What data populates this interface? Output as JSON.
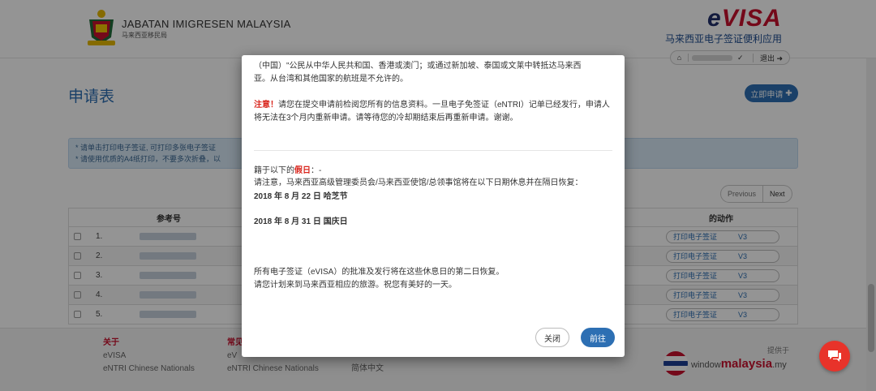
{
  "header": {
    "org_title": "JABATAN IMIGRESEN MALAYSIA",
    "org_subtitle": "马来西亚移民局",
    "logo_text": "eVISA",
    "app_subtitle": "马来西亚电子签证便利应用",
    "nav": {
      "home_icon": "home-icon",
      "user_dropdown_icon": "chevron-down-icon",
      "logout_label": "退出"
    }
  },
  "page": {
    "title": "申请表",
    "apply_button": "立即申请",
    "notice_lines": [
      "* 请单击打印电子签证, 可打印多张电子签证",
      "* 请使用优质的A4纸打印，不要多次折叠，以"
    ],
    "pager": {
      "prev": "Previous",
      "next": "Next"
    },
    "table": {
      "headers": {
        "ref": "参考号",
        "action": "的动作"
      },
      "rows": [
        {
          "num": "1.",
          "action": "打印电子签证",
          "version": "V3"
        },
        {
          "num": "2.",
          "action": "打印电子签证",
          "version": "V3"
        },
        {
          "num": "3.",
          "action": "打印电子签证",
          "version": "V3"
        },
        {
          "num": "4.",
          "action": "打印电子签证",
          "version": "V3"
        },
        {
          "num": "5.",
          "action": "打印电子签证",
          "version": "V3"
        }
      ]
    }
  },
  "footer": {
    "col1": {
      "heading": "关于",
      "lines": [
        "eVISA",
        "eNTRI Chinese Nationals"
      ]
    },
    "col2": {
      "heading": "常见",
      "lines": [
        "eV",
        "eNTRI Chinese Nationals"
      ]
    },
    "col3": {
      "lines": [
        "简体中文"
      ]
    },
    "provided_by": "提供于",
    "brand_prefix": "window",
    "brand_main": "malaysia",
    "brand_suffix": ".my"
  },
  "modal": {
    "line_top1": "（中国）\"公民从中华人民共和国、香港或澳门；或通过新加坡、泰国或文莱中转抵达马来西",
    "line_top2": "亚。从台湾和其他国家的航班是不允许的。",
    "attention_label": "注意！",
    "attention_text": "请您在提交申请前检阅您所有的信息资料。一旦电子免签证（eNTRI）记单已经发行，申请人将无法在3个月内重新申请。请等待您的冷却期结束后再重新申请。谢谢。",
    "holiday_prefix": "籍于以下的",
    "holiday_label": "假日",
    "holiday_suffix": "：-",
    "holiday_desc": "请注意，马来西亚高级管理委员会/马来西亚使馆/总领事馆将在以下日期休息并在隔日恢复：",
    "date1": "2018 年 8 月 22 日 哈芝节",
    "date2": "2018 年 8 月 31 日 国庆日",
    "after1": "所有电子签证（eVISA）的批准及发行将在这些休息日的第二日恢复。",
    "after2": "请您计划来到马来西亚相应的旅游。祝您有美好的一天。",
    "close_button": "关闭",
    "go_button": "前往"
  },
  "colors": {
    "primary": "#2d6fb3",
    "accent_red": "#d9251c",
    "chat": "#e8332a"
  }
}
